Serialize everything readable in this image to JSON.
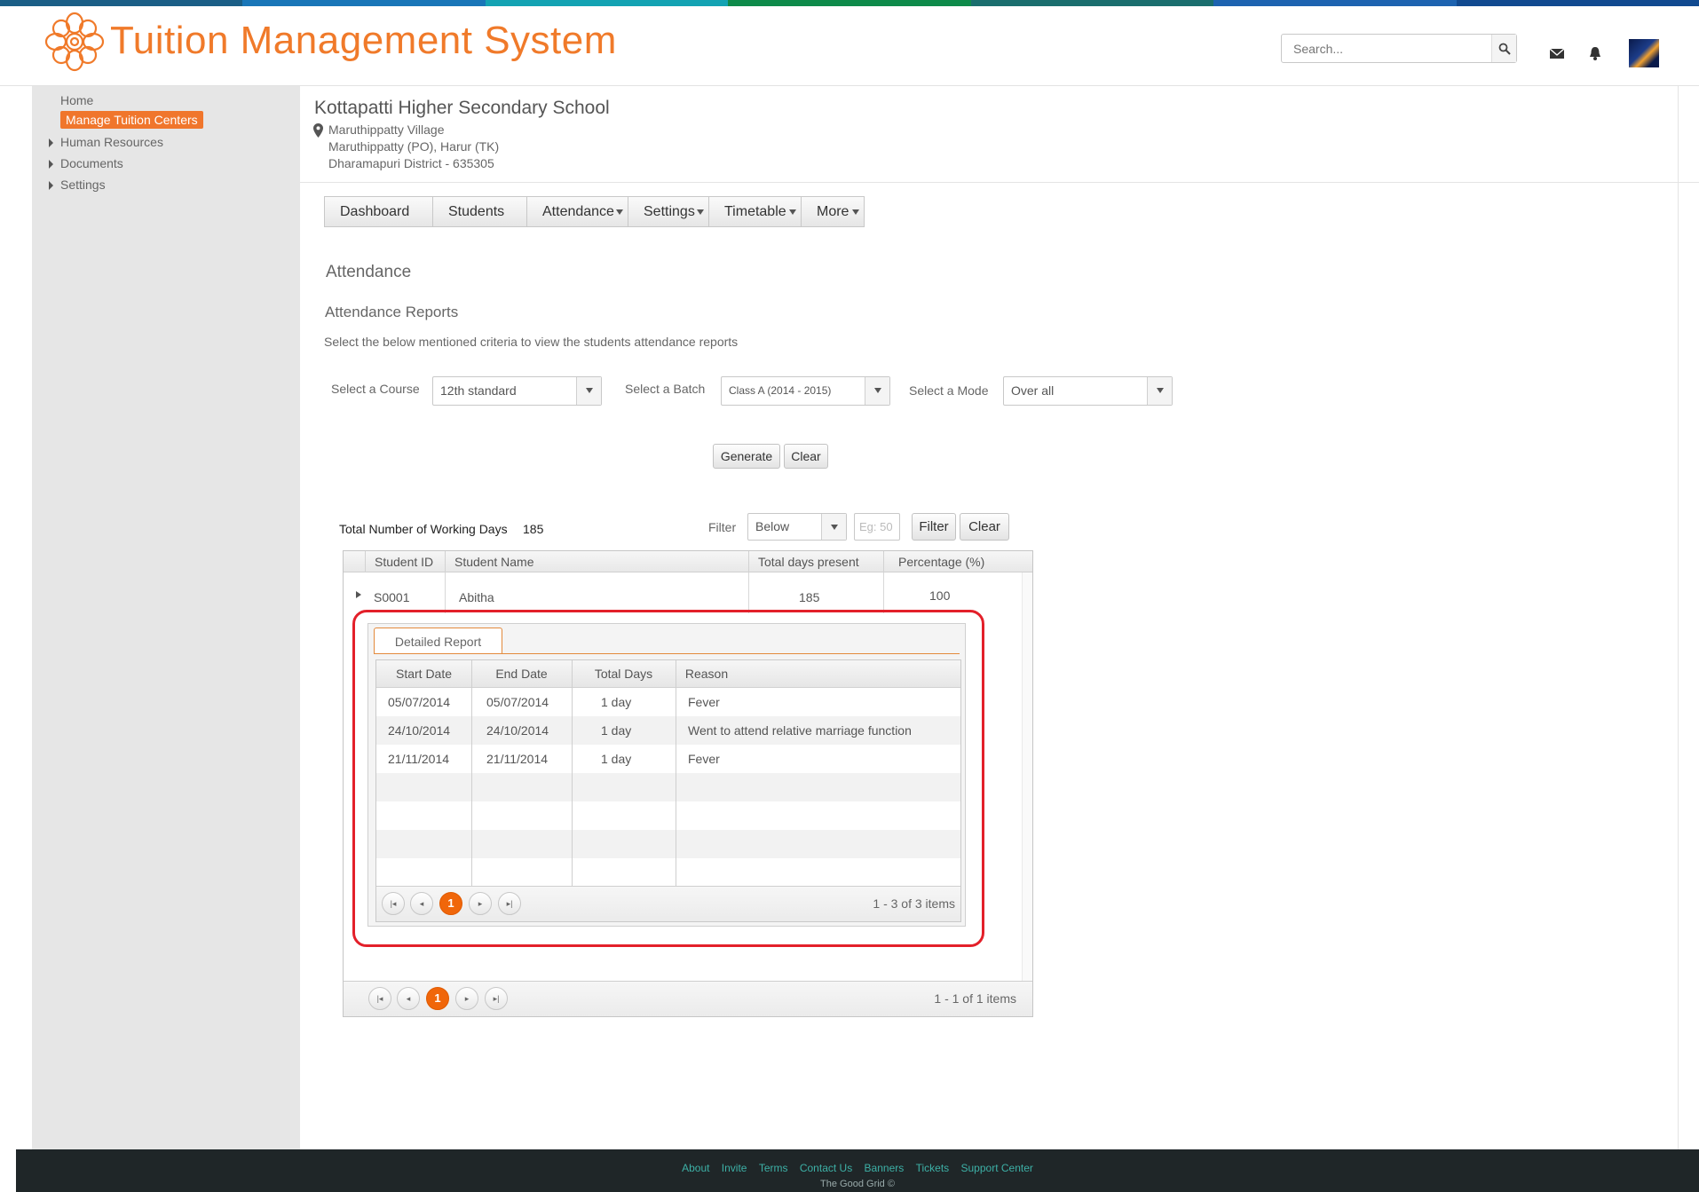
{
  "colors": {
    "accent": "#f07a2a",
    "highlight": "#e3202a",
    "footer_link": "#3db0a6"
  },
  "header": {
    "title": "Tuition Management System",
    "search_placeholder": "Search...",
    "icons": [
      "search-icon",
      "mail-icon",
      "bell-icon",
      "avatar"
    ]
  },
  "sidebar": {
    "items": [
      {
        "label": "Home"
      },
      {
        "label": "Manage Tuition  Centers"
      },
      {
        "label": "Human Resources"
      },
      {
        "label": "Documents"
      },
      {
        "label": "Settings"
      }
    ]
  },
  "school": {
    "name": "Kottapatti Higher Secondary School",
    "address": [
      "Maruthippatty Village",
      "Maruthippatty (PO), Harur (TK)",
      "Dharamapuri District - 635305"
    ]
  },
  "menu": [
    "Dashboard",
    "Students",
    "Attendance",
    "Settings",
    "Timetable",
    "More"
  ],
  "page": {
    "heading": "Attendance",
    "subheading": "Attendance Reports",
    "description": "Select the below mentioned criteria to view the students attendance reports"
  },
  "criteria": {
    "course_label": "Select a Course",
    "course_value": "12th standard",
    "batch_label": "Select a Batch",
    "batch_value": "Class A (2014 - 2015)",
    "mode_label": "Select a Mode",
    "mode_value": "Over all",
    "generate": "Generate",
    "clear": "Clear"
  },
  "summary": {
    "working_days_label": "Total Number of Working Days",
    "working_days": "185",
    "filter_label": "Filter",
    "filter_value": "Below",
    "filter_placeholder": "Eg: 50",
    "filter_button": "Filter",
    "clear_button": "Clear"
  },
  "grid": {
    "columns": [
      "Student ID",
      "Student Name",
      "Total days present",
      "Percentage (%)"
    ],
    "rows": [
      {
        "id": "S0001",
        "name": "Abitha",
        "present": "185",
        "percentage": "100"
      }
    ],
    "pager": {
      "page": "1",
      "info": "1 - 1 of 1 items"
    }
  },
  "detail": {
    "tab": "Detailed Report",
    "columns": [
      "Start Date",
      "End Date",
      "Total Days",
      "Reason"
    ],
    "rows": [
      {
        "start": "05/07/2014",
        "end": "05/07/2014",
        "days": "1 day",
        "reason": "Fever"
      },
      {
        "start": "24/10/2014",
        "end": "24/10/2014",
        "days": "1 day",
        "reason": "Went to attend relative marriage function"
      },
      {
        "start": "21/11/2014",
        "end": "21/11/2014",
        "days": "1 day",
        "reason": "Fever"
      }
    ],
    "pager": {
      "page": "1",
      "info": "1 - 3 of 3 items"
    }
  },
  "footer": {
    "links": [
      "About",
      "Invite",
      "Terms",
      "Contact Us",
      "Banners",
      "Tickets",
      "Support Center"
    ],
    "copyright": "The Good Grid ©"
  }
}
